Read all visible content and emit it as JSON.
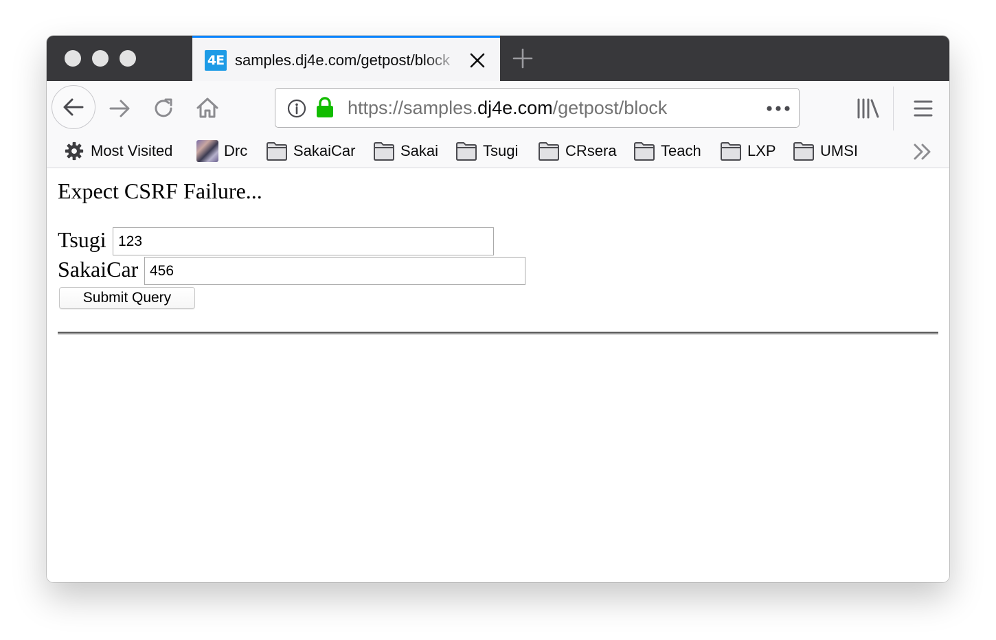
{
  "browser": {
    "tab": {
      "favicon_text": "4E",
      "title": "samples.dj4e.com/getpost/block"
    },
    "address": {
      "scheme": "https://",
      "subdomain": "samples.",
      "host": "dj4e.com",
      "path": "/getpost/block"
    },
    "bookmarks": [
      {
        "label": "Most Visited",
        "icon": "gear-icon"
      },
      {
        "label": "Drc",
        "icon": "avatar-image"
      },
      {
        "label": "SakaiCar",
        "icon": "folder-icon"
      },
      {
        "label": "Sakai",
        "icon": "folder-icon"
      },
      {
        "label": "Tsugi",
        "icon": "folder-icon"
      },
      {
        "label": "CRsera",
        "icon": "folder-icon"
      },
      {
        "label": "Teach",
        "icon": "folder-icon"
      },
      {
        "label": "LXP",
        "icon": "folder-icon"
      },
      {
        "label": "UMSI",
        "icon": "folder-icon"
      }
    ],
    "colors": {
      "tab_accent": "#0a84ff",
      "lock_green": "#12bc00",
      "favicon_blue": "#1d9be6"
    }
  },
  "page": {
    "heading": "Expect CSRF Failure...",
    "form": {
      "fields": [
        {
          "label": "Tsugi",
          "value": "123"
        },
        {
          "label": "SakaiCar",
          "value": "456"
        }
      ],
      "submit_label": "Submit Query"
    }
  }
}
